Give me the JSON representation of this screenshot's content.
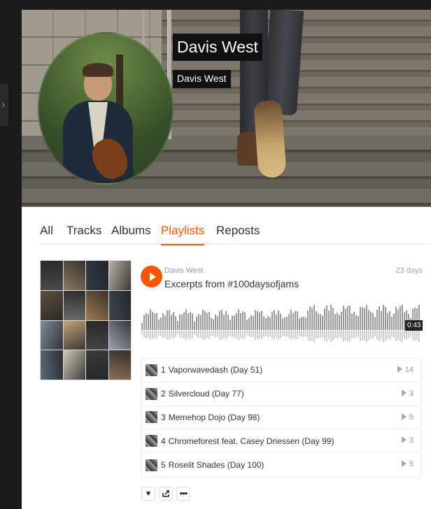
{
  "profile": {
    "name": "Davis West",
    "subtitle": "Davis West"
  },
  "tabs": [
    {
      "label": "All",
      "active": false
    },
    {
      "label": "Tracks",
      "active": false
    },
    {
      "label": "Albums",
      "active": false
    },
    {
      "label": "Playlists",
      "active": true
    },
    {
      "label": "Reposts",
      "active": false
    }
  ],
  "playlist": {
    "user": "Davis West",
    "title": "Excerpts from #100daysofjams",
    "posted": "23 days",
    "duration": "0:43",
    "tracks": [
      {
        "num": "1",
        "title": "Vaporwavedash (Day 51)",
        "plays": "14"
      },
      {
        "num": "2",
        "title": "Silvercloud (Day 77)",
        "plays": "3"
      },
      {
        "num": "3",
        "title": "Memehop Dojo (Day 98)",
        "plays": "5"
      },
      {
        "num": "4",
        "title": "Chromeforest feat. Casey Driessen (Day 99)",
        "plays": "3"
      },
      {
        "num": "5",
        "title": "Roselit Shades (Day 100)",
        "plays": "5"
      }
    ]
  },
  "actions": {
    "like_icon": "heart-icon",
    "share_icon": "share-icon",
    "more_icon": "more-icon"
  },
  "colors": {
    "accent": "#ff5500"
  }
}
